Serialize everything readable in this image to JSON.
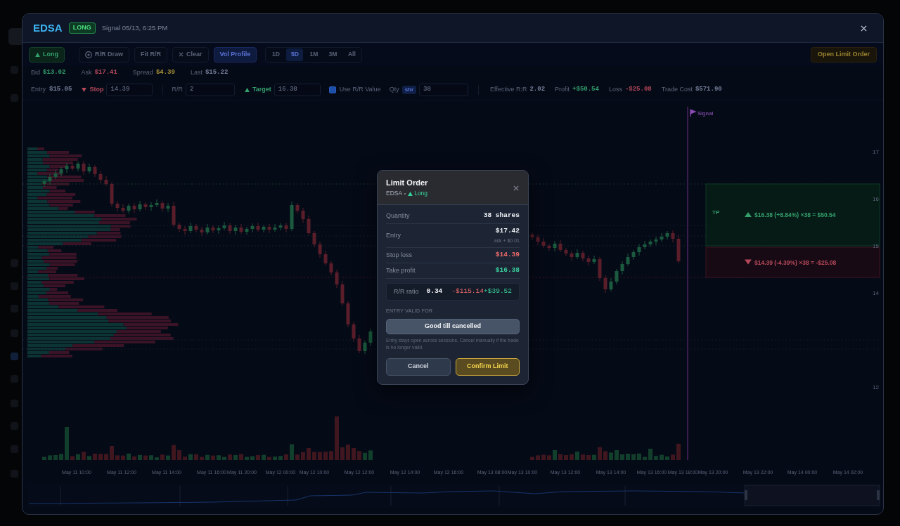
{
  "window": {
    "symbol": "EDSA",
    "badge": {
      "label": "LONG",
      "kind": "long"
    },
    "signal": "Signal 05/13, 6:25 PM"
  },
  "toolbar": {
    "buttons": [
      {
        "kind": "direction",
        "label": "Long",
        "selected": true
      },
      {
        "kind": "target",
        "label": "R/R Draw",
        "selected": false
      },
      {
        "kind": "plain",
        "label": "Fit R/R",
        "selected": false
      },
      {
        "kind": "clear",
        "label": "Clear",
        "selected": false
      },
      {
        "kind": "plain",
        "label": "Vol Profile",
        "selected": true
      }
    ],
    "ranges": [
      {
        "label": "1D",
        "selected": false
      },
      {
        "label": "5D",
        "selected": true
      },
      {
        "label": "1M",
        "selected": false
      },
      {
        "label": "3M",
        "selected": false
      },
      {
        "label": "All",
        "selected": false
      }
    ],
    "action": "Open Limit Order"
  },
  "quotes": [
    {
      "kind": "bid",
      "label": "Bid",
      "value": "$13.02"
    },
    {
      "kind": "ask",
      "label": "Ask",
      "value": "$17.41"
    },
    {
      "kind": "spread",
      "label": "Spread",
      "value": "$4.39"
    },
    {
      "kind": "last",
      "label": "Last",
      "value": "$15.22"
    }
  ],
  "order_bar": {
    "fields": [
      {
        "kind": "static",
        "label": "Entry",
        "value": "$15.05"
      },
      {
        "kind": "stop",
        "label": "Stop",
        "value": "14.39"
      },
      {
        "kind": "input",
        "label": "R/R",
        "value": "2"
      },
      {
        "kind": "target",
        "label": "Target",
        "value": "16.38"
      },
      {
        "kind": "checkbox",
        "label": "Use R/R Value",
        "checked": true
      },
      {
        "kind": "qty",
        "label": "Qty",
        "unit": "shr",
        "value": "38"
      }
    ],
    "stats": [
      {
        "kind": "neutral",
        "label": "Effective R:R",
        "value": "2.02"
      },
      {
        "kind": "profit",
        "label": "Profit",
        "value": "+$50.54"
      },
      {
        "kind": "loss",
        "label": "Loss",
        "value": "-$25.08"
      },
      {
        "kind": "neutral",
        "label": "Trade Cost",
        "value": "$571.90"
      }
    ]
  },
  "chart": {
    "signal_label": "Signal",
    "price_labels": [
      "17",
      "16",
      "15",
      "14",
      "12"
    ],
    "zones": [
      {
        "kind": "target",
        "tag": "TP",
        "text": "$16.38 (+8.84%) ×38 = $50.54"
      },
      {
        "kind": "stop",
        "text": "$14.39 (-4.39%) ×38 = -$25.08"
      }
    ],
    "time_labels": [
      "May 11 10:00",
      "May 11 12:00",
      "May 11 14:00",
      "May 11 16:00",
      "May 11 20:00",
      "May 12 00:00",
      "May 12 10:00",
      "May 12 12:00",
      "May 12 14:00",
      "May 12 16:00",
      "May 13 08:00",
      "May 13 10:00",
      "May 13 12:00",
      "May 13 14:00",
      "May 13 16:00",
      "May 13 18:00",
      "May 13 20:00",
      "May 13 22:00",
      "May 14 00:00",
      "May 14 02:00"
    ]
  },
  "dialog": {
    "title": "Limit Order",
    "symbol": "EDSA",
    "side": {
      "kind": "long",
      "label": "Long"
    },
    "rows": [
      {
        "kind": "plain",
        "label": "Quantity",
        "value": "38 shares"
      },
      {
        "kind": "plain",
        "label": "Entry",
        "value": "$17.42",
        "note": "ask + $0.01"
      },
      {
        "kind": "loss",
        "label": "Stop loss",
        "value": "$14.39"
      },
      {
        "kind": "gain",
        "label": "Take profit",
        "value": "$16.38"
      }
    ],
    "rr": {
      "label": "R/R ratio",
      "ratio": "0.34",
      "loss": "-$115.14",
      "gain": "+$39.52"
    },
    "validity": {
      "heading": "ENTRY VALID FOR",
      "option": "Good till cancelled",
      "note": "Entry stays open across sessions. Cancel manually if the trade is no longer valid."
    },
    "buttons": [
      {
        "kind": "cancel",
        "label": "Cancel"
      },
      {
        "kind": "confirm",
        "label": "Confirm Limit"
      }
    ]
  }
}
